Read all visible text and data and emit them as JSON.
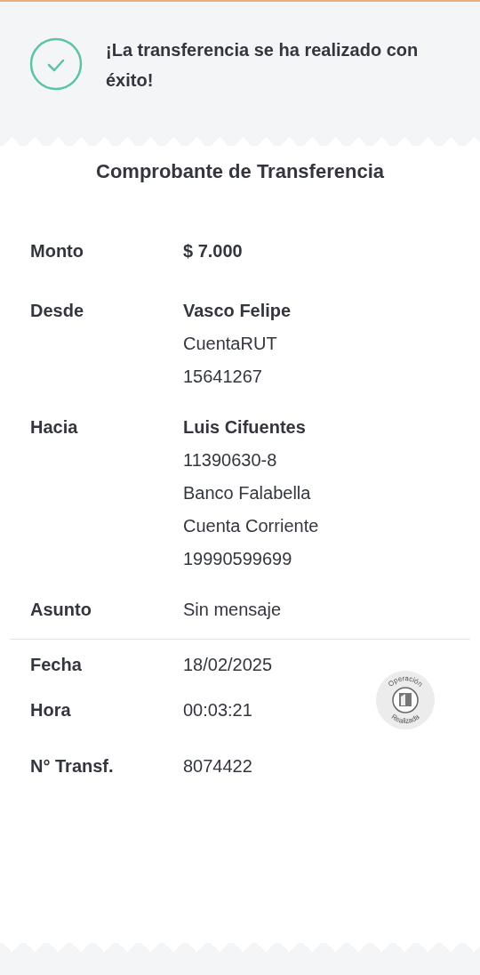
{
  "banner": {
    "message": "¡La transferencia se ha realizado con éxito!"
  },
  "receipt": {
    "title": "Comprobante de Transferencia",
    "details": [
      {
        "label": "Monto",
        "lines": [
          {
            "text": "$ 7.000",
            "bold": true
          }
        ]
      },
      {
        "label": "Desde",
        "lines": [
          {
            "text": "Vasco Felipe",
            "bold": true
          },
          {
            "text": "CuentaRUT",
            "bold": false
          },
          {
            "text": "15641267",
            "bold": false
          }
        ]
      },
      {
        "label": "Hacia",
        "lines": [
          {
            "text": "Luis Cifuentes",
            "bold": true
          },
          {
            "text": "11390630-8",
            "bold": false
          },
          {
            "text": "Banco Falabella",
            "bold": false
          },
          {
            "text": "Cuenta Corriente",
            "bold": false
          },
          {
            "text": "19990599699",
            "bold": false
          }
        ]
      },
      {
        "label": "Asunto",
        "lines": [
          {
            "text": "Sin mensaje",
            "bold": false
          }
        ]
      }
    ],
    "meta": [
      {
        "label": "Fecha",
        "value": "18/02/2025"
      },
      {
        "label": "Hora",
        "value": "00:03:21"
      },
      {
        "label": "N° Transf.",
        "value": "8074422"
      }
    ],
    "stamp": {
      "top_text": "Operación",
      "bottom_text": "Realizada"
    }
  }
}
